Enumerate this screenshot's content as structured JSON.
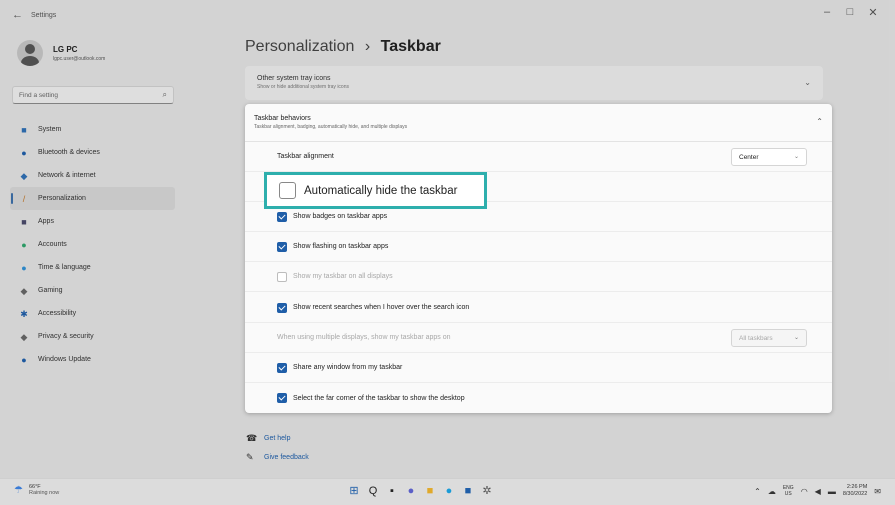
{
  "window": {
    "title": "Settings",
    "back_glyph": "←",
    "controls": {
      "minimize": "–",
      "maximize": "□",
      "close": "✕"
    }
  },
  "profile": {
    "name": "LG PC",
    "email": "lgpc.user@outlook.com"
  },
  "search": {
    "placeholder": "Find a setting",
    "icon": "search-icon"
  },
  "sidebar": {
    "items": [
      {
        "label": "System",
        "icon": "monitor-icon",
        "glyph": "■",
        "color": "#2f6fb3"
      },
      {
        "label": "Bluetooth & devices",
        "icon": "bluetooth-icon",
        "glyph": "●",
        "color": "#1f5ea8"
      },
      {
        "label": "Network & internet",
        "icon": "wifi-icon",
        "glyph": "◆",
        "color": "#2f6fb3"
      },
      {
        "label": "Personalization",
        "icon": "brush-icon",
        "glyph": "/",
        "color": "#c0792e",
        "active": true
      },
      {
        "label": "Apps",
        "icon": "apps-icon",
        "glyph": "■",
        "color": "#4a4a6a"
      },
      {
        "label": "Accounts",
        "icon": "person-icon",
        "glyph": "●",
        "color": "#2ea36b"
      },
      {
        "label": "Time & language",
        "icon": "globe-icon",
        "glyph": "●",
        "color": "#2f8fd3"
      },
      {
        "label": "Gaming",
        "icon": "gamepad-icon",
        "glyph": "◆",
        "color": "#666"
      },
      {
        "label": "Accessibility",
        "icon": "accessibility-icon",
        "glyph": "✱",
        "color": "#1f5ea8"
      },
      {
        "label": "Privacy & security",
        "icon": "shield-icon",
        "glyph": "◆",
        "color": "#666"
      },
      {
        "label": "Windows Update",
        "icon": "update-icon",
        "glyph": "●",
        "color": "#1f5ea8"
      }
    ]
  },
  "breadcrumb": {
    "parent": "Personalization",
    "separator": "›",
    "current": "Taskbar"
  },
  "tray_icons_card": {
    "title": "Other system tray icons",
    "subtitle": "Show or hide additional system tray icons",
    "chevron": "⌄"
  },
  "behaviors": {
    "title": "Taskbar behaviors",
    "subtitle": "Taskbar alignment, badging, automatically hide, and multiple displays",
    "chevron": "⌃",
    "alignment": {
      "label": "Taskbar alignment",
      "value": "Center",
      "chevron": "⌄"
    },
    "auto_hide": {
      "label": "Automatically hide the taskbar",
      "checked": false
    },
    "badges": {
      "label": "Show badges on taskbar apps",
      "checked": true
    },
    "flashing": {
      "label": "Show flashing on taskbar apps",
      "checked": true
    },
    "all_displays": {
      "label": "Show my taskbar on all displays",
      "checked": false
    },
    "recent_searches": {
      "label": "Show recent searches when I hover over the search icon",
      "checked": true
    },
    "multi_display": {
      "label": "When using multiple displays, show my taskbar apps on",
      "value": "All taskbars",
      "chevron": "⌄"
    },
    "share_window": {
      "label": "Share any window from my taskbar",
      "checked": true
    },
    "far_corner": {
      "label": "Select the far corner of the taskbar to show the desktop",
      "checked": true
    }
  },
  "links": {
    "help": {
      "label": "Get help",
      "icon": "help-icon",
      "glyph": "☎"
    },
    "feedback": {
      "label": "Give feedback",
      "icon": "feedback-icon",
      "glyph": "✎"
    }
  },
  "taskbar": {
    "weather": {
      "temp": "66°F",
      "status": "Raining now",
      "glyph": "☂"
    },
    "apps": [
      {
        "name": "start-icon",
        "glyph": "⊞",
        "color": "#1f5ea8"
      },
      {
        "name": "search-icon",
        "glyph": "Q",
        "color": "#222"
      },
      {
        "name": "task-view-icon",
        "glyph": "▪",
        "color": "#222"
      },
      {
        "name": "chat-icon",
        "glyph": "●",
        "color": "#5b5fc7"
      },
      {
        "name": "file-explorer-icon",
        "glyph": "■",
        "color": "#e0a92b"
      },
      {
        "name": "edge-icon",
        "glyph": "●",
        "color": "#1a9bd7"
      },
      {
        "name": "store-icon",
        "glyph": "■",
        "color": "#1f5ea8"
      },
      {
        "name": "settings-icon",
        "glyph": "✲",
        "color": "#555"
      }
    ],
    "tray": {
      "chevron": "⌃",
      "cloud": "☁",
      "lang_top": "ENG",
      "lang_bottom": "US",
      "wifi": "◠",
      "volume": "◀",
      "battery": "▬",
      "time": "2:26 PM",
      "date": "8/30/2022",
      "notify": "✉"
    }
  }
}
